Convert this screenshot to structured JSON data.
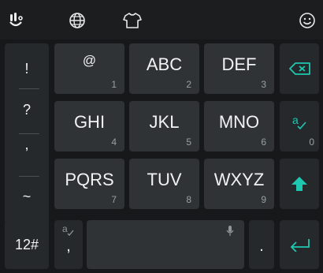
{
  "toolbar": {
    "icons": [
      "touchpal-logo-icon",
      "globe-icon",
      "tshirt-icon",
      "smiley-icon"
    ]
  },
  "left_column": {
    "symbols": [
      "!",
      "?",
      ",",
      "~"
    ]
  },
  "keys": [
    {
      "label": "@",
      "number": "1"
    },
    {
      "label": "ABC",
      "number": "2"
    },
    {
      "label": "DEF",
      "number": "3"
    },
    {
      "label": "GHI",
      "number": "4"
    },
    {
      "label": "JKL",
      "number": "5"
    },
    {
      "label": "MNO",
      "number": "6"
    },
    {
      "label": "PQRS",
      "number": "7"
    },
    {
      "label": "TUV",
      "number": "8"
    },
    {
      "label": "WXYZ",
      "number": "9"
    }
  ],
  "right_column": {
    "predict_number": "0"
  },
  "bottom_row": {
    "mode_label": "12#",
    "comma_label": ",",
    "period_label": "."
  },
  "colors": {
    "accent": "#1ec8b0",
    "key": "#2f3335",
    "background": "#161819"
  }
}
